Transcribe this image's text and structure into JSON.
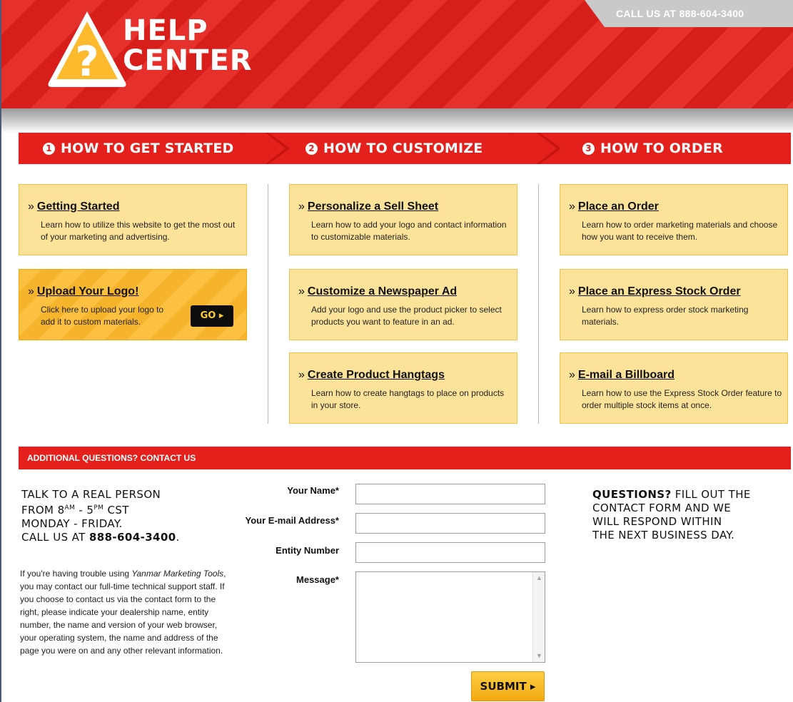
{
  "header": {
    "logo_line1": "HELP",
    "logo_line2": "CENTER",
    "call_tab": "CALL US AT 888-604-3400"
  },
  "steps": [
    {
      "number": "1",
      "label": "HOW TO GET STARTED"
    },
    {
      "number": "2",
      "label": "HOW TO CUSTOMIZE"
    },
    {
      "number": "3",
      "label": "HOW TO ORDER"
    }
  ],
  "columns": {
    "get_started": [
      {
        "title": "Getting Started",
        "desc": "Learn how to utilize this website to get the most out of your marketing and advertising."
      },
      {
        "title": "Upload Your Logo!",
        "desc": "Click here to upload your logo to add it to custom materials.",
        "button": "GO ▸"
      }
    ],
    "customize": [
      {
        "title": "Personalize a Sell Sheet",
        "desc": "Learn how to add your logo and contact information to customizable materials."
      },
      {
        "title": "Customize a Newspaper Ad",
        "desc": "Add your logo and use the product picker to select products you want to feature in an ad."
      },
      {
        "title": "Create Product Hangtags",
        "desc": "Learn how to create hangtags to place on products in your store."
      }
    ],
    "order": [
      {
        "title": "Place an Order",
        "desc": "Learn how to order marketing materials and choose how you want to receive them."
      },
      {
        "title": "Place an Express Stock Order",
        "desc": "Learn how to express order stock marketing materials."
      },
      {
        "title": "E-mail a Billboard",
        "desc": "Learn how to use the Express Stock Order feature to order multiple stock items at once."
      }
    ]
  },
  "contact": {
    "bar_title": "ADDITIONAL QUESTIONS? CONTACT US",
    "talk_line1": "TALK TO A REAL PERSON",
    "talk_line2_from": "FROM 8",
    "talk_line2_am": "AM",
    "talk_line2_mid": " - 5",
    "talk_line2_pm": "PM",
    "talk_line2_tz": " CST",
    "talk_line3": "MONDAY - FRIDAY.",
    "talk_line4_prefix": "CALL US AT ",
    "talk_line4_phone": "888-604-3400",
    "talk_line4_suffix": ".",
    "help_para_pre": "If you're having trouble using ",
    "help_para_em": "Yanmar Marketing Tools",
    "help_para_post": ", you may contact our full-time technical support staff. If you choose to contact us via the contact form to the right, please indicate your dealership name, entity number, the name and version of your web browser, your operating system, the name and address of the page you were on and any other relevant information.",
    "form": {
      "name_label": "Your Name*",
      "name_value": "",
      "email_label": "Your E-mail Address*",
      "email_value": "",
      "entity_label": "Entity Number",
      "entity_value": "",
      "message_label": "Message*",
      "message_value": "",
      "submit_label": "SUBMIT ▸"
    },
    "questions_bold": "QUESTIONS?",
    "questions_rest1": " FILL OUT THE",
    "questions_line2": "CONTACT FORM AND WE",
    "questions_line3": "WILL RESPOND WITHIN",
    "questions_line4": "THE NEXT BUSINESS DAY."
  },
  "colors": {
    "brand_red": "#e3201b",
    "card_yellow": "#fde39a",
    "upload_orange": "#fdba2c",
    "gray_tab": "#c9c9c9"
  }
}
